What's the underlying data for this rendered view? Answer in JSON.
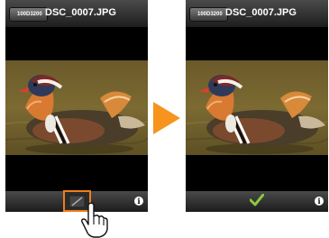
{
  "left_screen": {
    "back_button_label": "100D3200",
    "title": "DSC_0007.JPG",
    "photo_label": "mandarin duck photo",
    "info_icon": "info-icon",
    "edit_icon": "edit-icon"
  },
  "right_screen": {
    "back_button_label": "100D3200",
    "title": "DSC_0007.JPG",
    "photo_label": "mandarin duck photo",
    "info_icon": "info-icon",
    "confirm_icon": "checkmark-icon"
  },
  "colors": {
    "highlight": "#f07d1a",
    "arrow": "#f7941d",
    "checkmark": "#8cc63f"
  }
}
